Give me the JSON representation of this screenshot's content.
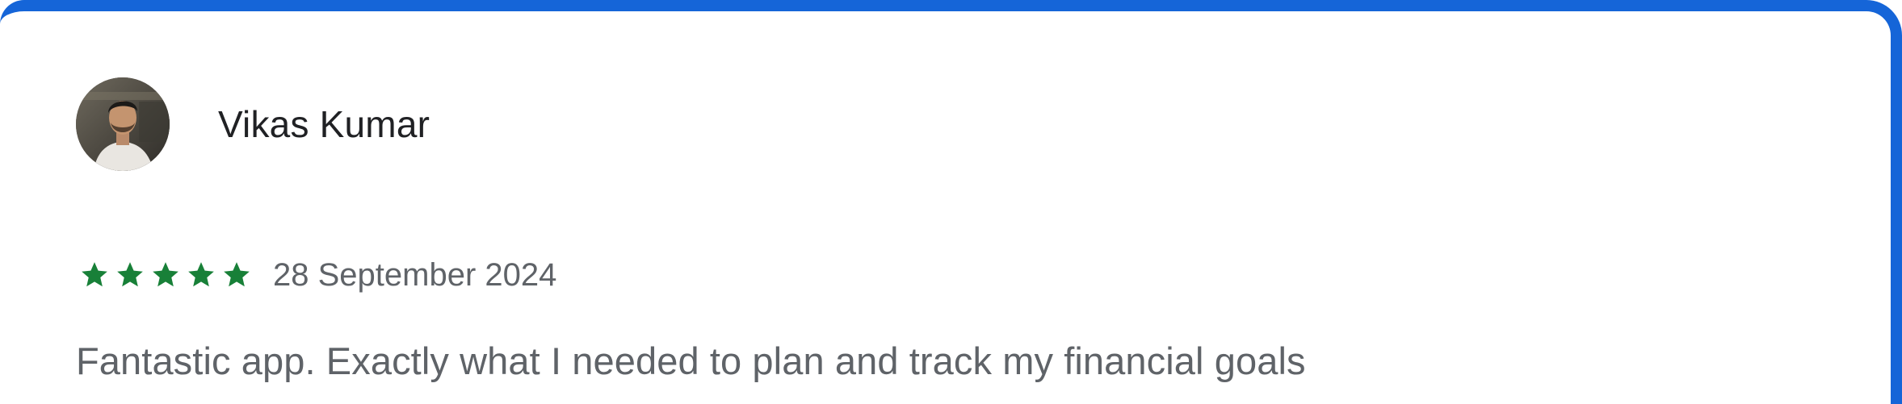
{
  "review": {
    "reviewer_name": "Vikas Kumar",
    "rating": 5,
    "rating_max": 5,
    "date": "28 September 2024",
    "text": "Fantastic app. Exactly what I needed to plan and track my financial goals"
  },
  "colors": {
    "frame_border": "#1565d8",
    "star": "#188038",
    "name_text": "#202124",
    "secondary_text": "#5f6368"
  },
  "icons": {
    "avatar": "reviewer-photo",
    "star": "star-icon"
  }
}
